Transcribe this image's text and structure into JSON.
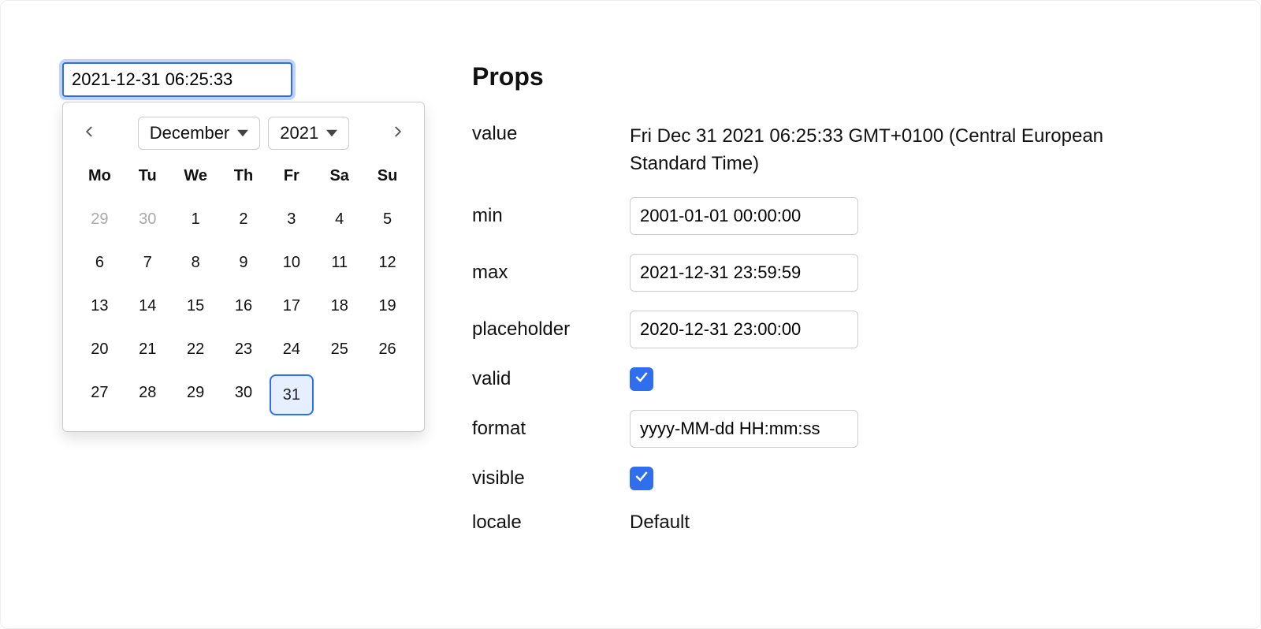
{
  "datepicker": {
    "input_value": "2021-12-31 06:25:33",
    "month": "December",
    "year": "2021",
    "days_of_week": [
      "Mo",
      "Tu",
      "We",
      "Th",
      "Fr",
      "Sa",
      "Su"
    ],
    "weeks": [
      [
        {
          "d": "29",
          "other": true
        },
        {
          "d": "30",
          "other": true
        },
        {
          "d": "1"
        },
        {
          "d": "2"
        },
        {
          "d": "3"
        },
        {
          "d": "4"
        },
        {
          "d": "5"
        }
      ],
      [
        {
          "d": "6"
        },
        {
          "d": "7"
        },
        {
          "d": "8"
        },
        {
          "d": "9"
        },
        {
          "d": "10"
        },
        {
          "d": "11"
        },
        {
          "d": "12"
        }
      ],
      [
        {
          "d": "13"
        },
        {
          "d": "14"
        },
        {
          "d": "15"
        },
        {
          "d": "16"
        },
        {
          "d": "17"
        },
        {
          "d": "18"
        },
        {
          "d": "19"
        }
      ],
      [
        {
          "d": "20"
        },
        {
          "d": "21"
        },
        {
          "d": "22"
        },
        {
          "d": "23"
        },
        {
          "d": "24"
        },
        {
          "d": "25"
        },
        {
          "d": "26"
        }
      ],
      [
        {
          "d": "27"
        },
        {
          "d": "28"
        },
        {
          "d": "29"
        },
        {
          "d": "30"
        },
        {
          "d": "31",
          "selected": true
        }
      ]
    ]
  },
  "props": {
    "heading": "Props",
    "labels": {
      "value": "value",
      "min": "min",
      "max": "max",
      "placeholder": "placeholder",
      "valid": "valid",
      "format": "format",
      "visible": "visible",
      "locale": "locale"
    },
    "value": "Fri Dec 31 2021 06:25:33 GMT+0100 (Central European Standard Time)",
    "min": "2001-01-01 00:00:00",
    "max": "2021-12-31 23:59:59",
    "placeholder": "2020-12-31 23:00:00",
    "valid": true,
    "format": "yyyy-MM-dd HH:mm:ss",
    "visible": true,
    "locale": "Default"
  }
}
